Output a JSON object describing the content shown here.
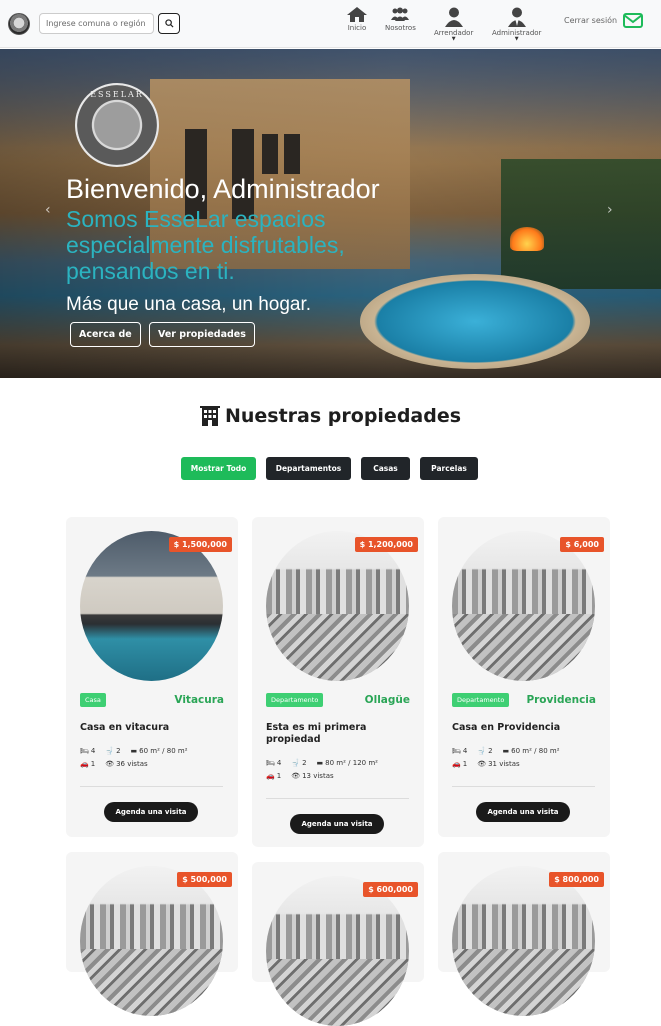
{
  "nav": {
    "search_placeholder": "Ingrese comuna o región",
    "items": [
      {
        "label": "Inicio",
        "icon": "home-icon"
      },
      {
        "label": "Nosotros",
        "icon": "users-icon"
      },
      {
        "label": "Arrendador",
        "icon": "user-icon"
      },
      {
        "label": "Administrador",
        "icon": "user-tie-icon"
      }
    ],
    "logout_label": "Cerrar sesión",
    "colors": {
      "logout_icon": "#1ebb5a"
    }
  },
  "hero": {
    "logo_text": "ESSELAR",
    "title": "Bienvenido, Administrador",
    "tagline": "Somos EsseLar espacios especialmente disfrutables, pensandos en ti.",
    "subtitle": "Más que una casa, un hogar.",
    "buttons": {
      "about": "Acerca de",
      "properties": "Ver propiedades"
    },
    "colors": {
      "tagline": "#2bb3c0"
    }
  },
  "properties": {
    "title": "Nuestras propiedades",
    "filters": [
      "Mostrar Todo",
      "Departamentos",
      "Casas",
      "Parcelas"
    ],
    "active_filter": "Mostrar Todo",
    "visit_label": "Agenda una visita",
    "colors": {
      "accent": "#1ebb5a",
      "price": "#e8542a",
      "badge": "#3ecf73"
    },
    "cards": [
      {
        "price": "$ 1,500,000",
        "type": "Casa",
        "comuna": "Vitacura",
        "title": "Casa en vitacura",
        "rooms": "4",
        "baths": "2",
        "area": "60 m² / 80 m²",
        "parking": "1",
        "views": "36 vistas",
        "photo": "modern-house-pool"
      },
      {
        "price": "$ 1,200,000",
        "type": "Departamento",
        "comuna": "Ollagüe",
        "title": "Esta es mi primera propiedad",
        "rooms": "4",
        "baths": "2",
        "area": "80 m² / 120 m²",
        "parking": "1",
        "views": "13 vistas",
        "photo": "city-sketch"
      },
      {
        "price": "$ 6,000",
        "type": "Departamento",
        "comuna": "Providencia",
        "title": "Casa en Providencia",
        "rooms": "4",
        "baths": "2",
        "area": "60 m² / 80 m²",
        "parking": "1",
        "views": "31 vistas",
        "photo": "city-sketch"
      },
      {
        "price": "$ 500,000",
        "photo": "city-sketch"
      },
      {
        "price": "$ 600,000",
        "photo": "city-sketch"
      },
      {
        "price": "$ 800,000",
        "photo": "city-sketch"
      }
    ]
  }
}
